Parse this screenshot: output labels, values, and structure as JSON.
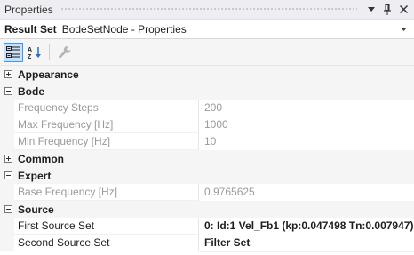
{
  "window": {
    "title": "Properties"
  },
  "object_selector": {
    "kind": "Result Set",
    "name": "BodeSetNode - Properties"
  },
  "toolbar": {
    "buttons": [
      {
        "icon": "categorized-icon",
        "active": true
      },
      {
        "icon": "alphabetical-sort-icon",
        "active": false
      },
      {
        "icon": "property-pages-wrench-icon",
        "active": false
      }
    ]
  },
  "grid": {
    "categories": [
      {
        "name": "Appearance",
        "expanded": false,
        "properties": []
      },
      {
        "name": "Bode",
        "expanded": true,
        "properties": [
          {
            "name": "Frequency Steps",
            "value": "200",
            "readonly": true
          },
          {
            "name": "Max Frequency [Hz]",
            "value": "1000",
            "readonly": true
          },
          {
            "name": "Min Frequency [Hz]",
            "value": "10",
            "readonly": true
          }
        ]
      },
      {
        "name": "Common",
        "expanded": false,
        "properties": []
      },
      {
        "name": "Expert",
        "expanded": true,
        "properties": [
          {
            "name": "Base Frequency [Hz]",
            "value": "0.9765625",
            "readonly": true
          }
        ]
      },
      {
        "name": "Source",
        "expanded": true,
        "properties": [
          {
            "name": "First Source Set",
            "value": "0: Id:1 Vel_Fb1 (kp:0.047498 Tn:0.007947)",
            "readonly": false,
            "bold": true
          },
          {
            "name": "Second Source Set",
            "value": "Filter Set",
            "readonly": false,
            "bold": true
          }
        ]
      }
    ]
  }
}
